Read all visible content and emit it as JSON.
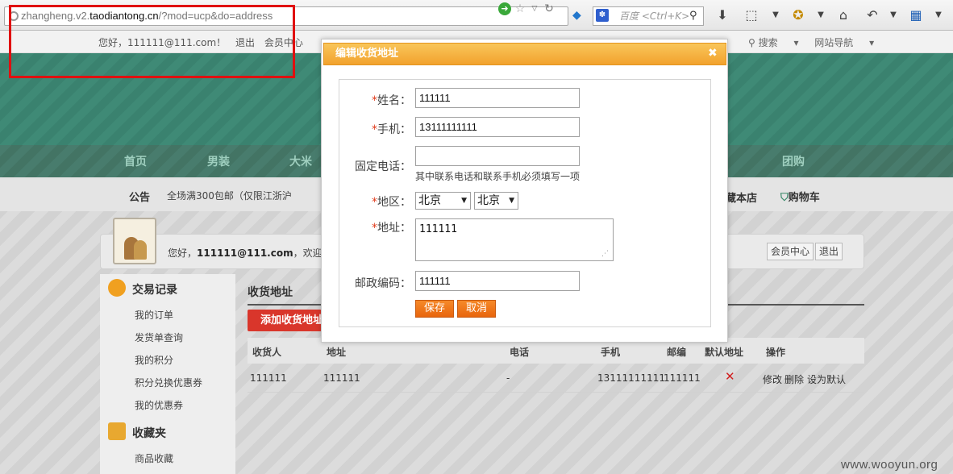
{
  "browser": {
    "url_prefix": "zhangheng.v2.",
    "url_host": "taodiantong.cn",
    "url_path": "/?mod=ucp&do=address",
    "search_placeholder": "百度 <Ctrl+K>"
  },
  "site_topbar": {
    "greeting": "您好，111111@111.com！",
    "logout": "退出",
    "member_center": "会员中心",
    "search_menu": "搜索",
    "site_nav": "网站导航"
  },
  "nav": {
    "home": "首页",
    "menswear": "男装",
    "big": "大米",
    "group_buy": "团购"
  },
  "notice": {
    "label": "公告",
    "text": "全场满300包邮（仅限江浙沪",
    "fav_store": "藏本店",
    "cart": "购物车"
  },
  "user_panel": {
    "hello": "您好，",
    "email": "111111@111.com",
    "suffix": "，欢迎光",
    "member_center_btn": "会员中心",
    "logout_btn": "退出"
  },
  "sidebar": {
    "section1": "交易记录",
    "items1": [
      "我的订单",
      "发货单查询",
      "我的积分",
      "积分兑换优惠券",
      "我的优惠券"
    ],
    "section2": "收藏夹",
    "items2": [
      "商品收藏"
    ]
  },
  "main": {
    "title": "收货地址",
    "add_button": "添加收货地址",
    "columns": [
      "收货人",
      "地址",
      "电话",
      "手机",
      "邮编",
      "默认地址",
      "操作"
    ],
    "row": {
      "name": "111111",
      "address": "111111",
      "phone": "-",
      "mobile": "13111111111",
      "zip": "111111",
      "actions": [
        "修改",
        "删除",
        "设为默认"
      ]
    }
  },
  "modal": {
    "title": "编辑收货地址",
    "required_mark": "*",
    "name_label": "姓名：",
    "name_value": "111111",
    "mobile_label": "手机：",
    "mobile_value": "13111111111",
    "tel_label": "固定电话：",
    "tel_value": "",
    "hint": "其中联系电话和联系手机必须填写一项",
    "region_label": "地区：",
    "province": "北京",
    "city": "北京",
    "address_label": "地址：",
    "address_value": "111111",
    "zip_label": "邮政编码：",
    "zip_value": "111111",
    "save": "保存",
    "cancel": "取消"
  },
  "watermark": "www.wooyun.org",
  "colors": {
    "accent_orange": "#f2a22e",
    "highlight_red": "#e01010",
    "nav_green": "#3f8a76"
  }
}
